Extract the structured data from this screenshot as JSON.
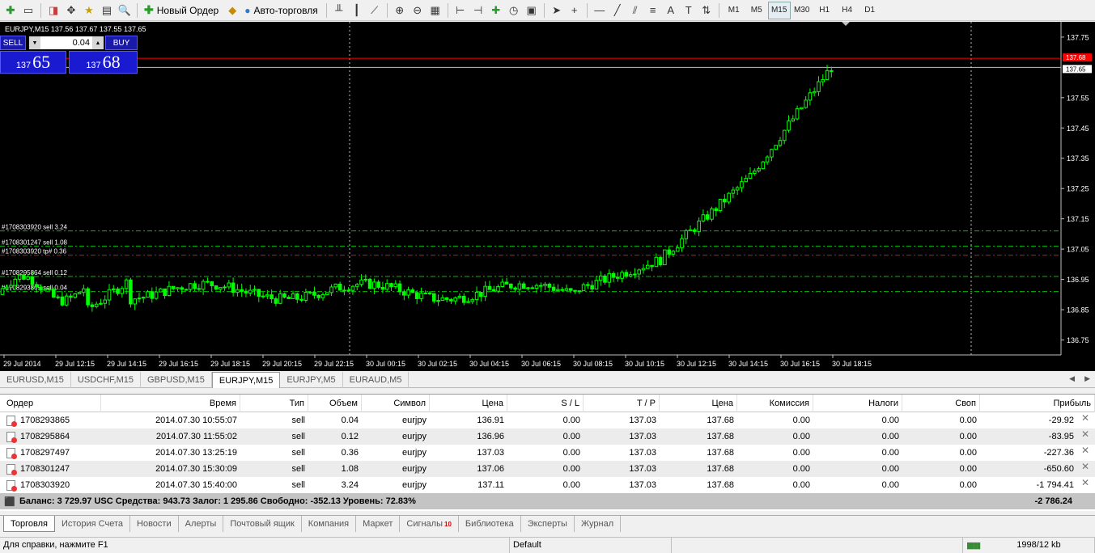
{
  "toolbar": {
    "new_order_label": "Новый Ордер",
    "auto_trading_label": "Авто-торговля",
    "timeframes": [
      "M1",
      "M5",
      "M15",
      "M30",
      "H1",
      "H4",
      "D1"
    ],
    "active_timeframe": "M15"
  },
  "chart": {
    "title": "EURJPY,M15  137.56 137.67 137.55 137.65",
    "oneclick": {
      "sell_label": "SELL",
      "buy_label": "BUY",
      "lot": "0.04",
      "sell_prefix": "137",
      "sell_big": "65",
      "buy_prefix": "137",
      "buy_big": "68"
    },
    "price_axis": [
      "137.75",
      "137.55",
      "137.45",
      "137.35",
      "137.25",
      "137.15",
      "137.05",
      "136.95",
      "136.85",
      "136.75"
    ],
    "ask_label": "137.68",
    "bid_label": "137.65",
    "time_axis": [
      "29 Jul 2014",
      "29 Jul 12:15",
      "29 Jul 14:15",
      "29 Jul 16:15",
      "29 Jul 18:15",
      "29 Jul 20:15",
      "29 Jul 22:15",
      "30 Jul 00:15",
      "30 Jul 02:15",
      "30 Jul 04:15",
      "30 Jul 06:15",
      "30 Jul 08:15",
      "30 Jul 10:15",
      "30 Jul 12:15",
      "30 Jul 14:15",
      "30 Jul 16:15",
      "30 Jul 18:15"
    ],
    "order_labels": [
      "#1708303920 sell 3.24",
      "#1708301247 sell 1.08",
      "#1708303920 tp# 0.36",
      "#1708295864 sell 0.12",
      "#1708293865 sell 0.04"
    ],
    "colors": {
      "background": "#000000",
      "candle": "#00ff00",
      "ask_line": "#ff0000",
      "bid_line": "#c0c0c0",
      "order_line": "#00c000",
      "tp_line": "#ff0000"
    }
  },
  "chart_tabs": [
    "EURUSD,M15",
    "USDCHF,M15",
    "GBPUSD,M15",
    "EURJPY,M15",
    "EURJPY,M5",
    "EURAUD,M5"
  ],
  "active_chart_tab": "EURJPY,M15",
  "terminal": {
    "columns": [
      "Ордер",
      "Время",
      "Тип",
      "Объем",
      "Символ",
      "Цена",
      "S / L",
      "T / P",
      "Цена",
      "Комиссия",
      "Налоги",
      "Своп",
      "Прибыль"
    ],
    "rows": [
      [
        "1708293865",
        "2014.07.30 10:55:07",
        "sell",
        "0.04",
        "eurjpy",
        "136.91",
        "0.00",
        "137.03",
        "137.68",
        "0.00",
        "0.00",
        "0.00",
        "-29.92"
      ],
      [
        "1708295864",
        "2014.07.30 11:55:02",
        "sell",
        "0.12",
        "eurjpy",
        "136.96",
        "0.00",
        "137.03",
        "137.68",
        "0.00",
        "0.00",
        "0.00",
        "-83.95"
      ],
      [
        "1708297497",
        "2014.07.30 13:25:19",
        "sell",
        "0.36",
        "eurjpy",
        "137.03",
        "0.00",
        "137.03",
        "137.68",
        "0.00",
        "0.00",
        "0.00",
        "-227.36"
      ],
      [
        "1708301247",
        "2014.07.30 15:30:09",
        "sell",
        "1.08",
        "eurjpy",
        "137.06",
        "0.00",
        "137.03",
        "137.68",
        "0.00",
        "0.00",
        "0.00",
        "-650.60"
      ],
      [
        "1708303920",
        "2014.07.30 15:40:00",
        "sell",
        "3.24",
        "eurjpy",
        "137.11",
        "0.00",
        "137.03",
        "137.68",
        "0.00",
        "0.00",
        "0.00",
        "-1 794.41"
      ]
    ],
    "balance_text": "Баланс: 3 729.97 USC  Средства: 943.73  Залог: 1 295.86  Свободно: -352.13  Уровень: 72.83%",
    "total_profit": "-2 786.24"
  },
  "terminal_tabs": [
    "Торговля",
    "История Счета",
    "Новости",
    "Алерты",
    "Почтовый ящик",
    "Компания",
    "Маркет",
    "Сигналы",
    "Библиотека",
    "Эксперты",
    "Журнал"
  ],
  "signals_badge": "10",
  "status": {
    "help": "Для справки, нажмите F1",
    "profile": "Default",
    "traffic": "1998/12 kb"
  }
}
